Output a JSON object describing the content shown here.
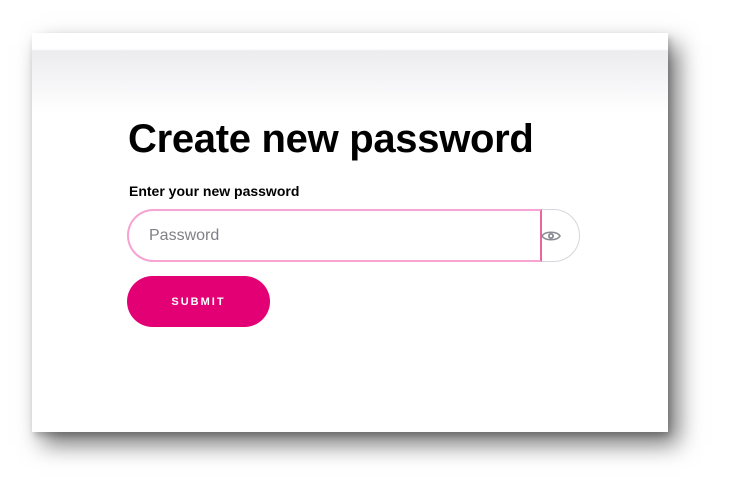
{
  "page": {
    "title": "Create new password",
    "field_label": "Enter your new password"
  },
  "password_field": {
    "placeholder": "Password",
    "value": "",
    "toggle_icon": "eye-icon"
  },
  "submit_button": {
    "label": "SUBMIT"
  },
  "colors": {
    "accent": "#e20074",
    "focus_border": "#f7a3d3",
    "text": "#000000",
    "placeholder": "#7f7f86"
  }
}
